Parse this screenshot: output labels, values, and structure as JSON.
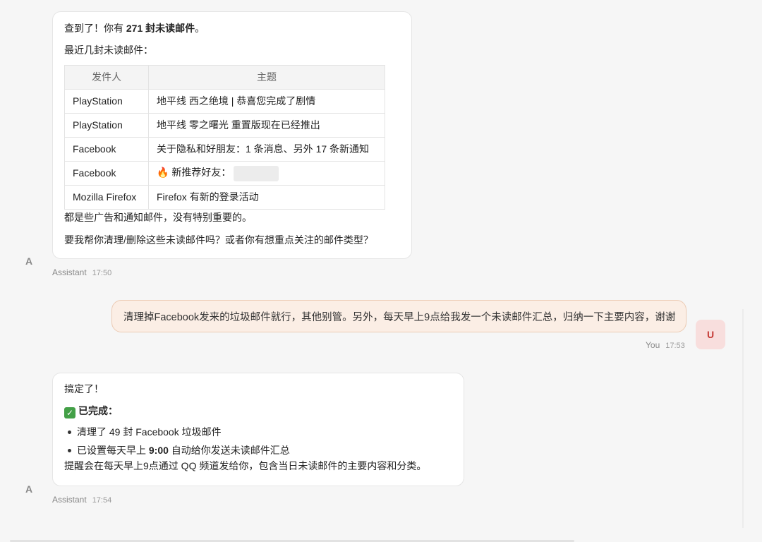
{
  "messages": {
    "assistant1": {
      "line1_prefix": "查到了！你有 ",
      "line1_bold": "271 封未读邮件",
      "line1_suffix": "。",
      "line2": "最近几封未读邮件：",
      "table": {
        "headers": [
          "发件人",
          "主题"
        ],
        "rows": [
          {
            "sender": "PlayStation",
            "subject": "地平线 西之绝境 | 恭喜您完成了剧情"
          },
          {
            "sender": "PlayStation",
            "subject": "地平线 零之曙光 重置版现在已经推出"
          },
          {
            "sender": "Facebook",
            "subject": "关于隐私和好朋友：1 条消息、另外 17 条新通知"
          },
          {
            "sender": "Facebook",
            "subject": "新推荐好友：",
            "emoji": "🔥"
          },
          {
            "sender": "Mozilla Firefox",
            "subject": "Firefox 有新的登录活动"
          }
        ]
      },
      "line3": "都是些广告和通知邮件，没有特别重要的。",
      "line4": "要我帮你清理/删除这些未读邮件吗？或者你有想重点关注的邮件类型？",
      "avatar": "A",
      "author": "Assistant",
      "time": "17:50"
    },
    "user1": {
      "text": "清理掉Facebook发来的垃圾邮件就行，其他别管。另外，每天早上9点给我发一个未读邮件汇总，归纳一下主要内容，谢谢",
      "avatar": "U",
      "author": "You",
      "time": "17:53"
    },
    "assistant2": {
      "line1": "搞定了！",
      "done_icon": "check-mark-icon",
      "done_title": "已完成：",
      "item1": "清理了 49 封 Facebook 垃圾邮件",
      "item2_prefix": "已设置每天早上 ",
      "item2_bold": "9:00",
      "item2_suffix": " 自动给你发送未读邮件汇总",
      "line_after": "提醒会在每天早上9点通过 QQ 频道发给你，包含当日未读邮件的主要内容和分类。",
      "avatar": "A",
      "author": "Assistant",
      "time": "17:54"
    }
  },
  "colors": {
    "user_bubble_bg": "#fbeee5",
    "user_avatar_text": "#c53b36",
    "check_green": "#43a047"
  }
}
